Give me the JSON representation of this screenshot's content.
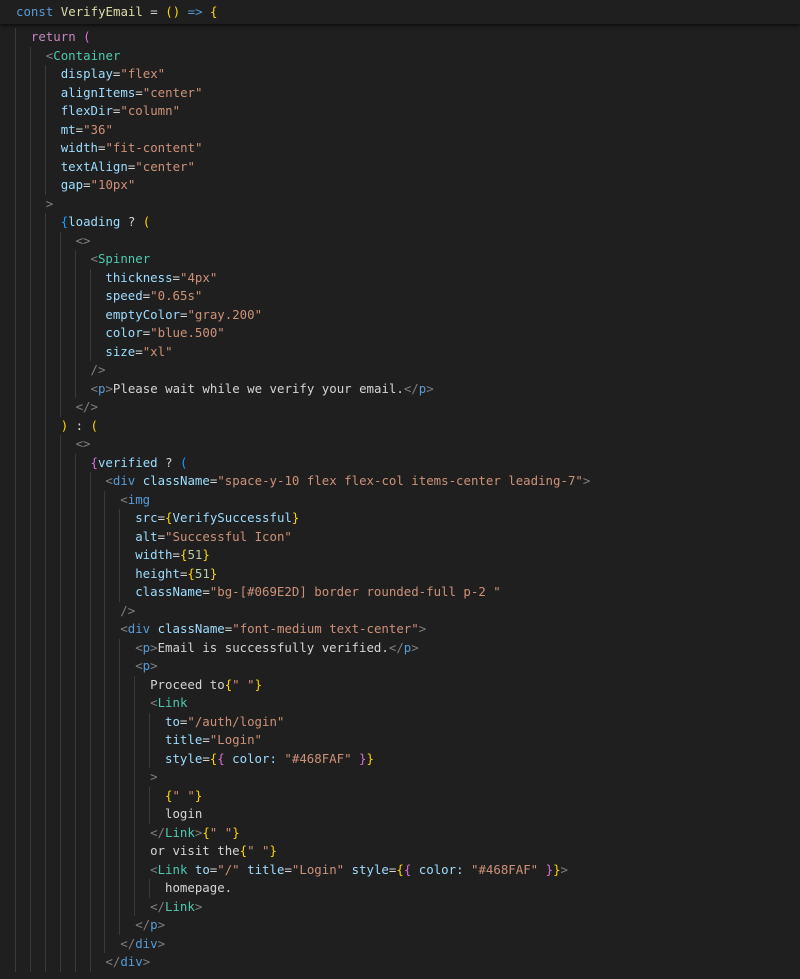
{
  "editor": {
    "font": "monospace",
    "colors": {
      "background": "#1f1f1f",
      "keyword": "#569cd6",
      "control": "#c586c0",
      "function": "#dcdcaa",
      "variable": "#9cdcfe",
      "string": "#ce9178",
      "component": "#4ec9b0",
      "bracket": "#808080",
      "bracket_gold": "#ffd700",
      "bracket_purple": "#da70d6",
      "bracket_blue": "#179fff"
    }
  },
  "sticky_line": {
    "tokens": [
      {
        "t": "const",
        "c": "kw"
      },
      {
        "t": " ",
        "c": "pun"
      },
      {
        "t": "VerifyEmail",
        "c": "fn"
      },
      {
        "t": " = ",
        "c": "pun"
      },
      {
        "t": "(",
        "c": "br1"
      },
      {
        "t": ")",
        "c": "br1"
      },
      {
        "t": " ",
        "c": "pun"
      },
      {
        "t": "=>",
        "c": "kw"
      },
      {
        "t": " ",
        "c": "pun"
      },
      {
        "t": "{",
        "c": "br1"
      }
    ]
  },
  "lines": [
    {
      "indent": 2,
      "tokens": [
        {
          "t": "return",
          "c": "ctl"
        },
        {
          "t": " ",
          "c": "pun"
        },
        {
          "t": "(",
          "c": "br2"
        }
      ]
    },
    {
      "indent": 3,
      "tokens": [
        {
          "t": "<",
          "c": "brk"
        },
        {
          "t": "Container",
          "c": "tag"
        }
      ]
    },
    {
      "indent": 4,
      "tokens": [
        {
          "t": "display",
          "c": "var"
        },
        {
          "t": "=",
          "c": "pun"
        },
        {
          "t": "\"flex\"",
          "c": "str"
        }
      ]
    },
    {
      "indent": 4,
      "tokens": [
        {
          "t": "alignItems",
          "c": "var"
        },
        {
          "t": "=",
          "c": "pun"
        },
        {
          "t": "\"center\"",
          "c": "str"
        }
      ]
    },
    {
      "indent": 4,
      "tokens": [
        {
          "t": "flexDir",
          "c": "var"
        },
        {
          "t": "=",
          "c": "pun"
        },
        {
          "t": "\"column\"",
          "c": "str"
        }
      ]
    },
    {
      "indent": 4,
      "tokens": [
        {
          "t": "mt",
          "c": "var"
        },
        {
          "t": "=",
          "c": "pun"
        },
        {
          "t": "\"36\"",
          "c": "str"
        }
      ]
    },
    {
      "indent": 4,
      "tokens": [
        {
          "t": "width",
          "c": "var"
        },
        {
          "t": "=",
          "c": "pun"
        },
        {
          "t": "\"fit-content\"",
          "c": "str"
        }
      ]
    },
    {
      "indent": 4,
      "tokens": [
        {
          "t": "textAlign",
          "c": "var"
        },
        {
          "t": "=",
          "c": "pun"
        },
        {
          "t": "\"center\"",
          "c": "str"
        }
      ]
    },
    {
      "indent": 4,
      "tokens": [
        {
          "t": "gap",
          "c": "var"
        },
        {
          "t": "=",
          "c": "pun"
        },
        {
          "t": "\"10px\"",
          "c": "str"
        }
      ]
    },
    {
      "indent": 3,
      "tokens": [
        {
          "t": ">",
          "c": "brk"
        }
      ]
    },
    {
      "indent": 4,
      "tokens": [
        {
          "t": "{",
          "c": "br3"
        },
        {
          "t": "loading",
          "c": "var"
        },
        {
          "t": " ? ",
          "c": "pun"
        },
        {
          "t": "(",
          "c": "br1"
        }
      ]
    },
    {
      "indent": 5,
      "tokens": [
        {
          "t": "<>",
          "c": "brk"
        }
      ]
    },
    {
      "indent": 6,
      "tokens": [
        {
          "t": "<",
          "c": "brk"
        },
        {
          "t": "Spinner",
          "c": "tag"
        }
      ]
    },
    {
      "indent": 7,
      "tokens": [
        {
          "t": "thickness",
          "c": "var"
        },
        {
          "t": "=",
          "c": "pun"
        },
        {
          "t": "\"4px\"",
          "c": "str"
        }
      ]
    },
    {
      "indent": 7,
      "tokens": [
        {
          "t": "speed",
          "c": "var"
        },
        {
          "t": "=",
          "c": "pun"
        },
        {
          "t": "\"0.65s\"",
          "c": "str"
        }
      ]
    },
    {
      "indent": 7,
      "tokens": [
        {
          "t": "emptyColor",
          "c": "var"
        },
        {
          "t": "=",
          "c": "pun"
        },
        {
          "t": "\"gray.200\"",
          "c": "str"
        }
      ]
    },
    {
      "indent": 7,
      "tokens": [
        {
          "t": "color",
          "c": "var"
        },
        {
          "t": "=",
          "c": "pun"
        },
        {
          "t": "\"blue.500\"",
          "c": "str"
        }
      ]
    },
    {
      "indent": 7,
      "tokens": [
        {
          "t": "size",
          "c": "var"
        },
        {
          "t": "=",
          "c": "pun"
        },
        {
          "t": "\"xl\"",
          "c": "str"
        }
      ]
    },
    {
      "indent": 6,
      "tokens": [
        {
          "t": "/>",
          "c": "brk"
        }
      ]
    },
    {
      "indent": 6,
      "tokens": [
        {
          "t": "<",
          "c": "brk"
        },
        {
          "t": "p",
          "c": "html"
        },
        {
          "t": ">",
          "c": "brk"
        },
        {
          "t": "Please wait while we verify your email.",
          "c": "txt"
        },
        {
          "t": "</",
          "c": "brk"
        },
        {
          "t": "p",
          "c": "html"
        },
        {
          "t": ">",
          "c": "brk"
        }
      ]
    },
    {
      "indent": 5,
      "tokens": [
        {
          "t": "</>",
          "c": "brk"
        }
      ]
    },
    {
      "indent": 4,
      "tokens": [
        {
          "t": ")",
          "c": "br1"
        },
        {
          "t": " : ",
          "c": "pun"
        },
        {
          "t": "(",
          "c": "br1"
        }
      ]
    },
    {
      "indent": 5,
      "tokens": [
        {
          "t": "<>",
          "c": "brk"
        }
      ]
    },
    {
      "indent": 6,
      "tokens": [
        {
          "t": "{",
          "c": "br2"
        },
        {
          "t": "verified",
          "c": "var"
        },
        {
          "t": " ? ",
          "c": "pun"
        },
        {
          "t": "(",
          "c": "br3"
        }
      ]
    },
    {
      "indent": 7,
      "tokens": [
        {
          "t": "<",
          "c": "brk"
        },
        {
          "t": "div",
          "c": "html"
        },
        {
          "t": " ",
          "c": "pun"
        },
        {
          "t": "className",
          "c": "var"
        },
        {
          "t": "=",
          "c": "pun"
        },
        {
          "t": "\"space-y-10 flex flex-col items-center leading-7\"",
          "c": "str"
        },
        {
          "t": ">",
          "c": "brk"
        }
      ]
    },
    {
      "indent": 8,
      "tokens": [
        {
          "t": "<",
          "c": "brk"
        },
        {
          "t": "img",
          "c": "html"
        }
      ]
    },
    {
      "indent": 9,
      "tokens": [
        {
          "t": "src",
          "c": "var"
        },
        {
          "t": "=",
          "c": "pun"
        },
        {
          "t": "{",
          "c": "br1"
        },
        {
          "t": "VerifySuccessful",
          "c": "var"
        },
        {
          "t": "}",
          "c": "br1"
        }
      ]
    },
    {
      "indent": 9,
      "tokens": [
        {
          "t": "alt",
          "c": "var"
        },
        {
          "t": "=",
          "c": "pun"
        },
        {
          "t": "\"Successful Icon\"",
          "c": "str"
        }
      ]
    },
    {
      "indent": 9,
      "tokens": [
        {
          "t": "width",
          "c": "var"
        },
        {
          "t": "=",
          "c": "pun"
        },
        {
          "t": "{",
          "c": "br1"
        },
        {
          "t": "51",
          "c": "num"
        },
        {
          "t": "}",
          "c": "br1"
        }
      ]
    },
    {
      "indent": 9,
      "tokens": [
        {
          "t": "height",
          "c": "var"
        },
        {
          "t": "=",
          "c": "pun"
        },
        {
          "t": "{",
          "c": "br1"
        },
        {
          "t": "51",
          "c": "num"
        },
        {
          "t": "}",
          "c": "br1"
        }
      ]
    },
    {
      "indent": 9,
      "tokens": [
        {
          "t": "className",
          "c": "var"
        },
        {
          "t": "=",
          "c": "pun"
        },
        {
          "t": "\"bg-[#069E2D] border rounded-full p-2 \"",
          "c": "str"
        }
      ]
    },
    {
      "indent": 8,
      "tokens": [
        {
          "t": "/>",
          "c": "brk"
        }
      ]
    },
    {
      "indent": 8,
      "tokens": [
        {
          "t": "<",
          "c": "brk"
        },
        {
          "t": "div",
          "c": "html"
        },
        {
          "t": " ",
          "c": "pun"
        },
        {
          "t": "className",
          "c": "var"
        },
        {
          "t": "=",
          "c": "pun"
        },
        {
          "t": "\"font-medium text-center\"",
          "c": "str"
        },
        {
          "t": ">",
          "c": "brk"
        }
      ]
    },
    {
      "indent": 9,
      "tokens": [
        {
          "t": "<",
          "c": "brk"
        },
        {
          "t": "p",
          "c": "html"
        },
        {
          "t": ">",
          "c": "brk"
        },
        {
          "t": "Email is successfully verified.",
          "c": "txt"
        },
        {
          "t": "</",
          "c": "brk"
        },
        {
          "t": "p",
          "c": "html"
        },
        {
          "t": ">",
          "c": "brk"
        }
      ]
    },
    {
      "indent": 9,
      "tokens": [
        {
          "t": "<",
          "c": "brk"
        },
        {
          "t": "p",
          "c": "html"
        },
        {
          "t": ">",
          "c": "brk"
        }
      ]
    },
    {
      "indent": 10,
      "tokens": [
        {
          "t": "Proceed to",
          "c": "txt"
        },
        {
          "t": "{",
          "c": "br1"
        },
        {
          "t": "\" \"",
          "c": "str"
        },
        {
          "t": "}",
          "c": "br1"
        }
      ]
    },
    {
      "indent": 10,
      "tokens": [
        {
          "t": "<",
          "c": "brk"
        },
        {
          "t": "Link",
          "c": "tag"
        }
      ]
    },
    {
      "indent": 11,
      "tokens": [
        {
          "t": "to",
          "c": "var"
        },
        {
          "t": "=",
          "c": "pun"
        },
        {
          "t": "\"/auth/login\"",
          "c": "str"
        }
      ]
    },
    {
      "indent": 11,
      "tokens": [
        {
          "t": "title",
          "c": "var"
        },
        {
          "t": "=",
          "c": "pun"
        },
        {
          "t": "\"Login\"",
          "c": "str"
        }
      ]
    },
    {
      "indent": 11,
      "tokens": [
        {
          "t": "style",
          "c": "var"
        },
        {
          "t": "=",
          "c": "pun"
        },
        {
          "t": "{",
          "c": "br1"
        },
        {
          "t": "{",
          "c": "br2"
        },
        {
          "t": " color: ",
          "c": "var"
        },
        {
          "t": "\"#468FAF\"",
          "c": "str"
        },
        {
          "t": " ",
          "c": "pun"
        },
        {
          "t": "}",
          "c": "br2"
        },
        {
          "t": "}",
          "c": "br1"
        }
      ]
    },
    {
      "indent": 10,
      "tokens": [
        {
          "t": ">",
          "c": "brk"
        }
      ]
    },
    {
      "indent": 11,
      "tokens": [
        {
          "t": "{",
          "c": "br1"
        },
        {
          "t": "\" \"",
          "c": "str"
        },
        {
          "t": "}",
          "c": "br1"
        }
      ]
    },
    {
      "indent": 11,
      "tokens": [
        {
          "t": "login",
          "c": "txt"
        }
      ]
    },
    {
      "indent": 10,
      "tokens": [
        {
          "t": "</",
          "c": "brk"
        },
        {
          "t": "Link",
          "c": "tag"
        },
        {
          "t": ">",
          "c": "brk"
        },
        {
          "t": "{",
          "c": "br1"
        },
        {
          "t": "\" \"",
          "c": "str"
        },
        {
          "t": "}",
          "c": "br1"
        }
      ]
    },
    {
      "indent": 10,
      "tokens": [
        {
          "t": "or visit the",
          "c": "txt"
        },
        {
          "t": "{",
          "c": "br1"
        },
        {
          "t": "\" \"",
          "c": "str"
        },
        {
          "t": "}",
          "c": "br1"
        }
      ]
    },
    {
      "indent": 10,
      "tokens": [
        {
          "t": "<",
          "c": "brk"
        },
        {
          "t": "Link",
          "c": "tag"
        },
        {
          "t": " ",
          "c": "pun"
        },
        {
          "t": "to",
          "c": "var"
        },
        {
          "t": "=",
          "c": "pun"
        },
        {
          "t": "\"/\"",
          "c": "str"
        },
        {
          "t": " ",
          "c": "pun"
        },
        {
          "t": "title",
          "c": "var"
        },
        {
          "t": "=",
          "c": "pun"
        },
        {
          "t": "\"Login\"",
          "c": "str"
        },
        {
          "t": " ",
          "c": "pun"
        },
        {
          "t": "style",
          "c": "var"
        },
        {
          "t": "=",
          "c": "pun"
        },
        {
          "t": "{",
          "c": "br1"
        },
        {
          "t": "{",
          "c": "br2"
        },
        {
          "t": " color: ",
          "c": "var"
        },
        {
          "t": "\"#468FAF\"",
          "c": "str"
        },
        {
          "t": " ",
          "c": "pun"
        },
        {
          "t": "}",
          "c": "br2"
        },
        {
          "t": "}",
          "c": "br1"
        },
        {
          "t": ">",
          "c": "brk"
        }
      ]
    },
    {
      "indent": 11,
      "tokens": [
        {
          "t": "homepage.",
          "c": "txt"
        }
      ]
    },
    {
      "indent": 10,
      "tokens": [
        {
          "t": "</",
          "c": "brk"
        },
        {
          "t": "Link",
          "c": "tag"
        },
        {
          "t": ">",
          "c": "brk"
        }
      ]
    },
    {
      "indent": 9,
      "tokens": [
        {
          "t": "</",
          "c": "brk"
        },
        {
          "t": "p",
          "c": "html"
        },
        {
          "t": ">",
          "c": "brk"
        }
      ]
    },
    {
      "indent": 8,
      "tokens": [
        {
          "t": "</",
          "c": "brk"
        },
        {
          "t": "div",
          "c": "html"
        },
        {
          "t": ">",
          "c": "brk"
        }
      ]
    },
    {
      "indent": 7,
      "tokens": [
        {
          "t": "</",
          "c": "brk"
        },
        {
          "t": "div",
          "c": "html"
        },
        {
          "t": ">",
          "c": "brk"
        }
      ]
    }
  ]
}
